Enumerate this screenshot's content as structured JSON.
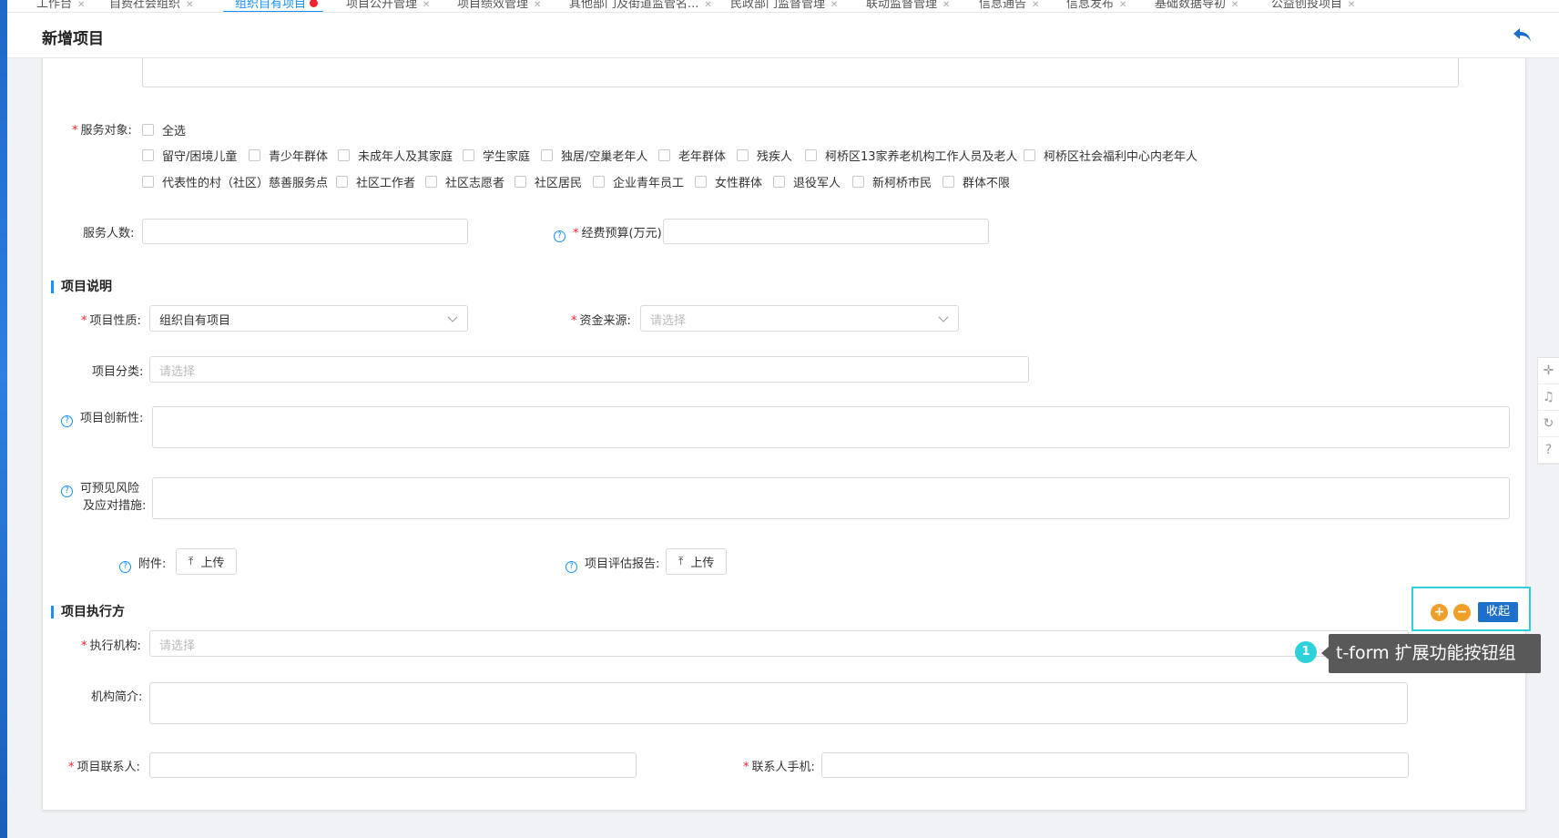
{
  "tabs": [
    {
      "label": "工作台",
      "active": false,
      "closable": true
    },
    {
      "label": "自费社会组织",
      "active": false,
      "closable": true
    },
    {
      "label": "组织自有项目",
      "active": true,
      "closable": false,
      "dot": true
    },
    {
      "label": "项目公开管理",
      "active": false,
      "closable": true
    },
    {
      "label": "项目绩效管理",
      "active": false,
      "closable": true
    },
    {
      "label": "其他部门及街道监管名...",
      "active": false,
      "closable": true
    },
    {
      "label": "民政部门监督管理",
      "active": false,
      "closable": true
    },
    {
      "label": "联动监督管理",
      "active": false,
      "closable": true
    },
    {
      "label": "信息通告",
      "active": false,
      "closable": true
    },
    {
      "label": "信息发布",
      "active": false,
      "closable": true
    },
    {
      "label": "基础数据导初",
      "active": false,
      "closable": true
    },
    {
      "label": "公益创投项目",
      "active": false,
      "closable": true
    }
  ],
  "header": {
    "title": "新增项目"
  },
  "service_target": {
    "label": "服务对象:",
    "select_all": "全选",
    "row1": [
      "留守/困境儿童",
      "青少年群体",
      "未成年人及其家庭",
      "学生家庭",
      "独居/空巢老年人",
      "老年群体",
      "残疾人",
      "柯桥区13家养老机构工作人员及老人",
      "柯桥区社会福利中心内老年人"
    ],
    "row2": [
      "代表性的村（社区）慈善服务点",
      "社区工作者",
      "社区志愿者",
      "社区居民",
      "企业青年员工",
      "女性群体",
      "退役军人",
      "新柯桥市民",
      "群体不限"
    ]
  },
  "service_count": {
    "label": "服务人数:",
    "value": ""
  },
  "budget": {
    "label": "经费预算(万元):",
    "value": ""
  },
  "section_desc": {
    "title": "项目说明"
  },
  "project_nature": {
    "label": "项目性质:",
    "value": "组织自有项目"
  },
  "fund_source": {
    "label": "资金来源:",
    "placeholder": "请选择"
  },
  "project_category": {
    "label": "项目分类:",
    "placeholder": "请选择"
  },
  "innovation": {
    "label": "项目创新性:"
  },
  "risk": {
    "label_line1": "可预见风险",
    "label_line2": "及应对措施:"
  },
  "attachment": {
    "label": "附件:",
    "button": "上传"
  },
  "eval_report": {
    "label": "项目评估报告:",
    "button": "上传"
  },
  "section_exec": {
    "title": "项目执行方"
  },
  "exec_org": {
    "label": "执行机构:",
    "placeholder": "请选择"
  },
  "org_intro": {
    "label": "机构简介:"
  },
  "contact": {
    "label": "项目联系人:",
    "value": ""
  },
  "contact_phone": {
    "label": "联系人手机:",
    "value": ""
  },
  "extension": {
    "add": "+",
    "remove": "−",
    "collapse": "收起"
  },
  "annotation": {
    "number": "1",
    "text": "t-form 扩展功能按钮组"
  },
  "colors": {
    "primary": "#1890ff",
    "required": "#f5222d",
    "highlight": "#2ed0da",
    "ext_circle": "#f0a02a",
    "collapse_btn": "#1d6fc9"
  }
}
